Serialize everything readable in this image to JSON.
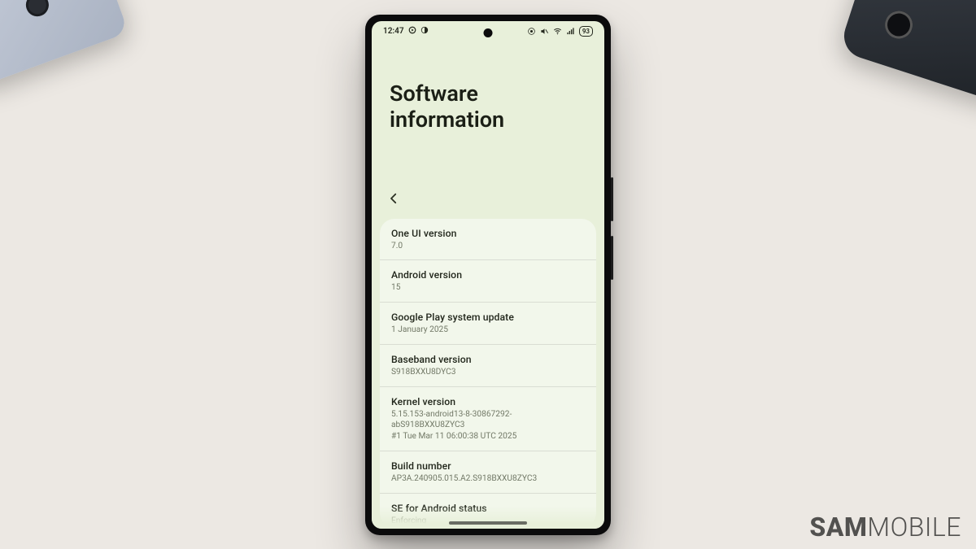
{
  "watermark": {
    "bold": "SAM",
    "light": "MOBILE"
  },
  "status": {
    "time": "12:47",
    "battery": "93"
  },
  "page": {
    "title": "Software information"
  },
  "rows": [
    {
      "label": "One UI version",
      "value": "7.0"
    },
    {
      "label": "Android version",
      "value": "15"
    },
    {
      "label": "Google Play system update",
      "value": "1 January 2025"
    },
    {
      "label": "Baseband version",
      "value": "S918BXXU8DYC3"
    },
    {
      "label": "Kernel version",
      "value": "5.15.153-android13-8-30867292-abS918BXXU8ZYC3\n#1 Tue Mar 11 06:00:38 UTC 2025"
    },
    {
      "label": "Build number",
      "value": "AP3A.240905.015.A2.S918BXXU8ZYC3"
    },
    {
      "label": "SE for Android status",
      "value": "Enforcing"
    }
  ]
}
